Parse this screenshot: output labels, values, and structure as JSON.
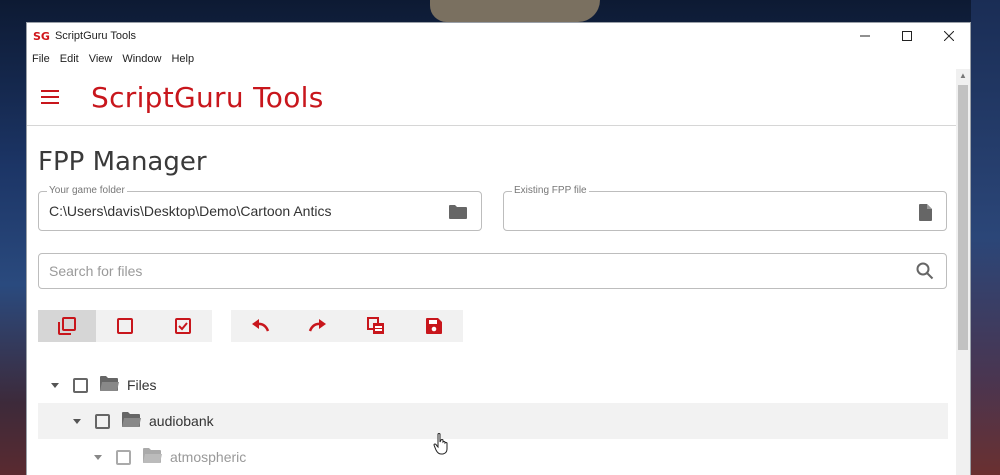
{
  "window": {
    "logo": "SG",
    "title": "ScriptGuru Tools",
    "controls": [
      "minimize",
      "maximize",
      "close"
    ]
  },
  "menu": [
    "File",
    "Edit",
    "View",
    "Window",
    "Help"
  ],
  "header": {
    "title": "ScriptGuru Tools"
  },
  "page": {
    "title": "FPP Manager",
    "game_folder": {
      "label": "Your game folder",
      "value": "C:\\Users\\davis\\Desktop\\Demo\\Cartoon Antics"
    },
    "fpp_file": {
      "label": "Existing FPP file",
      "value": ""
    },
    "search": {
      "placeholder": "Search for files"
    }
  },
  "toolbar": {
    "selection_group": [
      "select-all-icon",
      "checkbox-empty-icon",
      "checkbox-checked-icon"
    ],
    "action_group": [
      "undo-icon",
      "redo-icon",
      "copy-icon",
      "save-icon"
    ]
  },
  "tree": [
    {
      "label": "Files",
      "level": 0
    },
    {
      "label": "audiobank",
      "level": 1
    },
    {
      "label": "atmospheric",
      "level": 2
    }
  ],
  "colors": {
    "brand": "#c8161c"
  }
}
